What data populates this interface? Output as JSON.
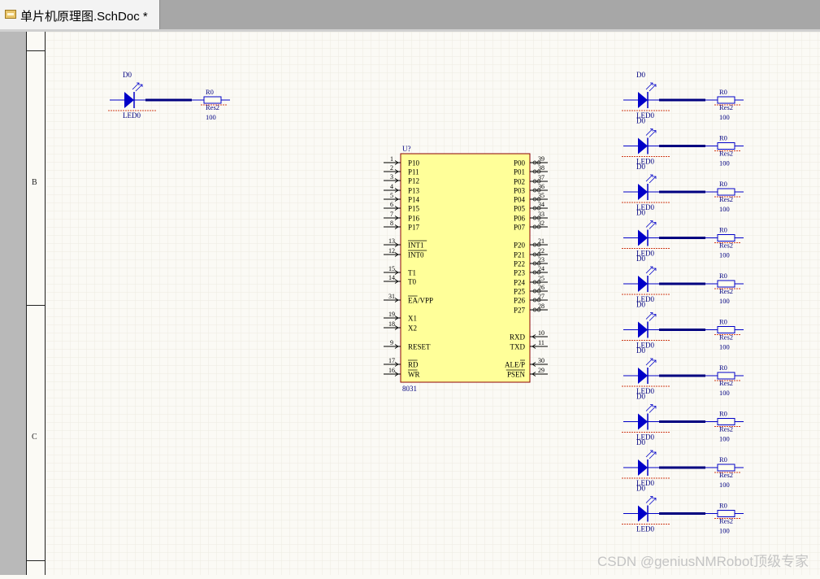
{
  "tab": {
    "title": "单片机原理图.SchDoc *"
  },
  "ruler": {
    "zones": [
      "B",
      "C"
    ]
  },
  "mcu": {
    "designator": "U?",
    "comment": "8031",
    "left_pins": [
      {
        "num": "1",
        "name": "P10"
      },
      {
        "num": "2",
        "name": "P11"
      },
      {
        "num": "3",
        "name": "P12"
      },
      {
        "num": "4",
        "name": "P13"
      },
      {
        "num": "5",
        "name": "P14"
      },
      {
        "num": "6",
        "name": "P15"
      },
      {
        "num": "7",
        "name": "P16"
      },
      {
        "num": "8",
        "name": "P17"
      },
      {
        "num": "13",
        "name": "INT1",
        "overbar": true
      },
      {
        "num": "12",
        "name": "INT0",
        "overbar": true
      },
      {
        "num": "15",
        "name": "T1"
      },
      {
        "num": "14",
        "name": "T0"
      },
      {
        "num": "31",
        "name": "EA/VPP",
        "overbar_part": "EA"
      },
      {
        "num": "19",
        "name": "X1"
      },
      {
        "num": "18",
        "name": "X2"
      },
      {
        "num": "9",
        "name": "RESET"
      },
      {
        "num": "17",
        "name": "RD",
        "overbar": true
      },
      {
        "num": "16",
        "name": "WR",
        "overbar": true
      }
    ],
    "right_pins": [
      {
        "num": "39",
        "name": "P00"
      },
      {
        "num": "38",
        "name": "P01"
      },
      {
        "num": "37",
        "name": "P02"
      },
      {
        "num": "36",
        "name": "P03"
      },
      {
        "num": "35",
        "name": "P04"
      },
      {
        "num": "34",
        "name": "P05"
      },
      {
        "num": "33",
        "name": "P06"
      },
      {
        "num": "32",
        "name": "P07"
      },
      {
        "num": "21",
        "name": "P20"
      },
      {
        "num": "22",
        "name": "P21"
      },
      {
        "num": "23",
        "name": "P22"
      },
      {
        "num": "24",
        "name": "P23"
      },
      {
        "num": "25",
        "name": "P24"
      },
      {
        "num": "26",
        "name": "P25"
      },
      {
        "num": "27",
        "name": "P26"
      },
      {
        "num": "28",
        "name": "P27"
      },
      {
        "num": "10",
        "name": "RXD"
      },
      {
        "num": "11",
        "name": "TXD"
      },
      {
        "num": "30",
        "name": "ALE/P",
        "overbar_part": "P"
      },
      {
        "num": "29",
        "name": "PSEN",
        "overbar": true
      }
    ]
  },
  "led_template": {
    "designator": "D0",
    "comment": "LED0"
  },
  "res_template": {
    "designator": "R0",
    "comment": "Res2",
    "value": "100"
  },
  "led_rows": {
    "count": 10
  },
  "watermark": "CSDN @geniusNMRobot顶级专家",
  "colors": {
    "component_blue": "#0000c8",
    "wire_navy": "#000080",
    "body_fill": "#ffff99",
    "body_stroke": "#8b0000",
    "red_dash": "#d04020",
    "grid": "#ecebe1"
  }
}
